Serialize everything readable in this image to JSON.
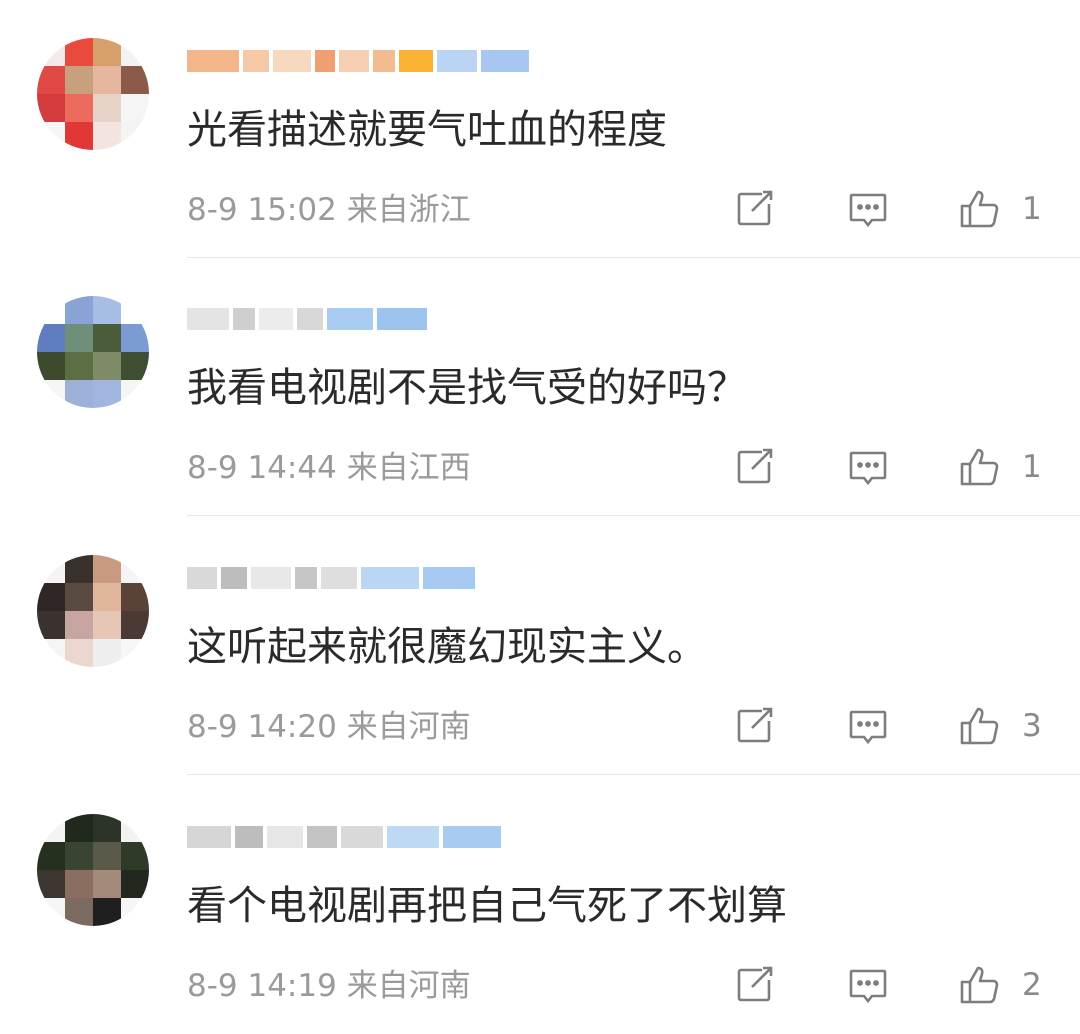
{
  "comments": [
    {
      "text": "光看描述就要气吐血的程度",
      "time": "8-9 15:02",
      "location": "来自浙江",
      "likes": "1",
      "avatar_colors": [
        "#f4eaea",
        "#e94a3d",
        "#d7a06a",
        "#f2f2f2",
        "#e04a44",
        "#c9a07e",
        "#e6b79e",
        "#8c5a4a",
        "#d23c3c",
        "#ed6b5c",
        "#e8d3c8",
        "#f5f5f5",
        "#f6f6f6",
        "#e13737",
        "#f3e4e0",
        "#f4f4f4"
      ],
      "name_colors": [
        "#f3b58a",
        "#f5c8a6",
        "#f7d9bf",
        "#f0a070",
        "#f6cfb2",
        "#f2bb92",
        "#f9b233",
        "#bcd4f4",
        "#a8c7f0"
      ]
    },
    {
      "text": "我看电视剧不是找气受的好吗？",
      "time": "8-9 14:44",
      "location": "来自江西",
      "likes": "1",
      "avatar_colors": [
        "#ffffff",
        "#8aa3d6",
        "#a8bde4",
        "#ffffff",
        "#5f7dbf",
        "#6f8f7a",
        "#4a5c3a",
        "#7c9bd2",
        "#3d4a2e",
        "#5b6e44",
        "#7f8b68",
        "#3f4d32",
        "#f5f5f5",
        "#9db0d8",
        "#a0b6e0",
        "#f5f5f5"
      ],
      "name_colors": [
        "#e4e4e4",
        "#cfcfcf",
        "#ececec",
        "#d8d8d8",
        "#a9cdf2",
        "#9dc4ef"
      ]
    },
    {
      "text": "这听起来就很魔幻现实主义。",
      "time": "8-9 14:20",
      "location": "来自河南",
      "likes": "3",
      "avatar_colors": [
        "#f4f4f4",
        "#3a302c",
        "#c89a80",
        "#f4f4f4",
        "#2f2725",
        "#5a4a42",
        "#e0b79c",
        "#5a4238",
        "#3a322e",
        "#c7a5a0",
        "#e6c6b4",
        "#4b3a34",
        "#f5f5f5",
        "#e9d7d0",
        "#eeeeee",
        "#f6f6f6"
      ],
      "name_colors": [
        "#d9d9d9",
        "#bdbdbd",
        "#e8e8e8",
        "#c6c6c6",
        "#dedede",
        "#b9d6f4",
        "#a6c9f2"
      ]
    },
    {
      "text": "看个电视剧再把自己气死了不划算",
      "time": "8-9 14:19",
      "location": "来自河南",
      "likes": "2",
      "avatar_colors": [
        "#f4f4f4",
        "#1f2a1c",
        "#2b3426",
        "#f2f2f2",
        "#26301f",
        "#3a4432",
        "#5b5a4a",
        "#2f3a28",
        "#3c3530",
        "#8a6f60",
        "#a38a7a",
        "#23281f",
        "#f5f5f5",
        "#7a6a60",
        "#1f1f1f",
        "#f6f6f6"
      ],
      "name_colors": [
        "#d6d6d6",
        "#bdbdbd",
        "#e6e6e6",
        "#c3c3c3",
        "#d9d9d9",
        "#bed9f4",
        "#a9cbf2"
      ]
    }
  ]
}
